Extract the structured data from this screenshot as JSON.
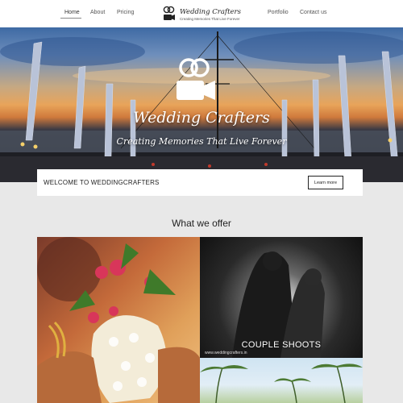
{
  "nav": {
    "left": [
      "Home",
      "About",
      "Pricing"
    ],
    "right": [
      "Portfolio",
      "Contact us"
    ],
    "active": "Home"
  },
  "logo": {
    "title": "Wedding Crafters",
    "tagline": "Creating Memories That Live Forever"
  },
  "hero": {
    "title": "Wedding Crafters",
    "tagline": "Creating Memories That Live Forever"
  },
  "welcome": {
    "text": "WELCOME TO WEDDINGCRAFTERS",
    "button_label": "Learn more"
  },
  "offer": {
    "heading": "What we offer",
    "tiles": [
      {
        "id": "wedding-tile"
      },
      {
        "id": "couple-tile",
        "label": "COUPLE SHOOTS",
        "watermark": "www.weddingcrafters.in"
      },
      {
        "id": "beach-tile"
      }
    ]
  }
}
